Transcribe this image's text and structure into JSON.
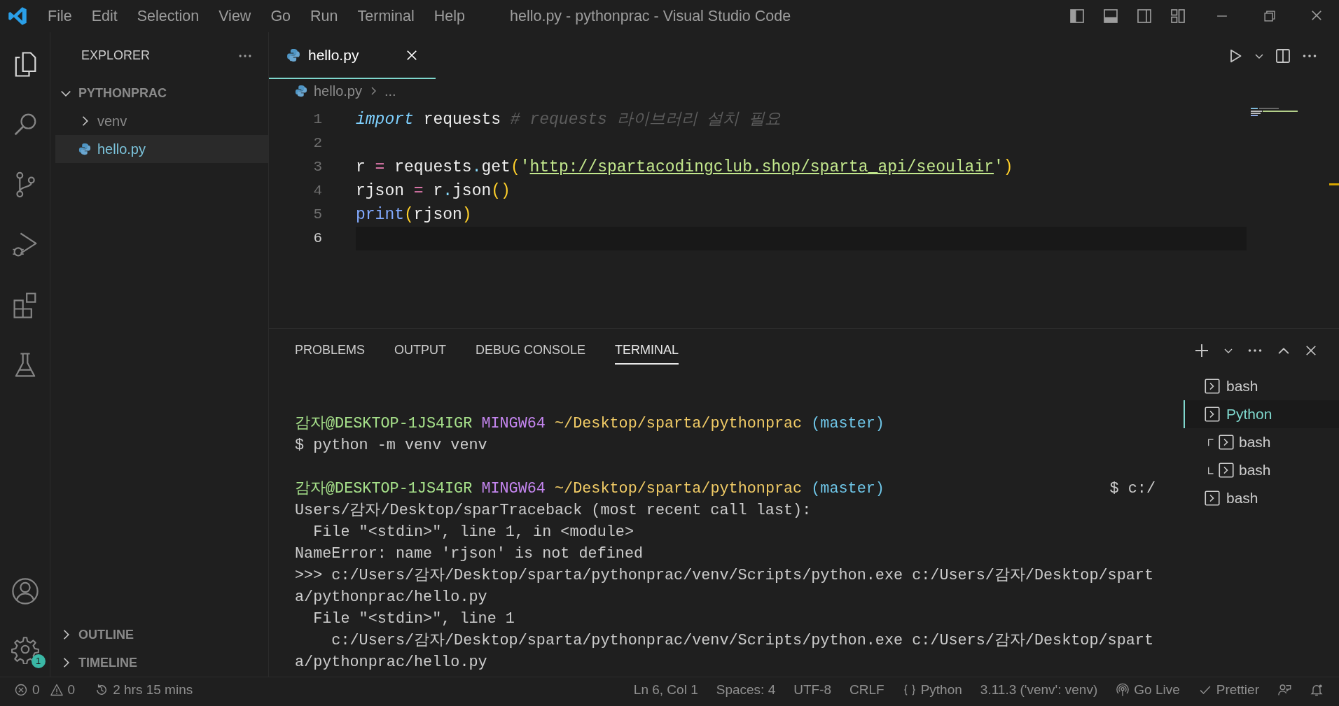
{
  "title_bar": {
    "menu": [
      "File",
      "Edit",
      "Selection",
      "View",
      "Go",
      "Run",
      "Terminal",
      "Help"
    ],
    "title": "hello.py - pythonprac - Visual Studio Code"
  },
  "activity_bar": {
    "items": [
      {
        "kind": "explorer",
        "selected": true
      },
      {
        "kind": "search",
        "selected": false
      },
      {
        "kind": "source-control",
        "selected": false
      },
      {
        "kind": "run-debug",
        "selected": false
      },
      {
        "kind": "extensions",
        "selected": false
      },
      {
        "kind": "testing",
        "selected": false
      }
    ],
    "manage_badge": "1"
  },
  "sidebar": {
    "title": "EXPLORER",
    "folder": {
      "name": "PYTHONPRAC",
      "expanded": true,
      "children": [
        {
          "kind": "folder",
          "name": "venv",
          "expanded": false,
          "selected": false
        },
        {
          "kind": "python",
          "name": "hello.py",
          "selected": true
        }
      ]
    },
    "sections": [
      {
        "name": "OUTLINE",
        "expanded": false
      },
      {
        "name": "TIMELINE",
        "expanded": false
      }
    ]
  },
  "editor": {
    "tabs": [
      {
        "label": "hello.py",
        "selected": true
      }
    ],
    "breadcrumb": {
      "file": "hello.py",
      "rest": "..."
    },
    "lines": [
      {
        "number": "1",
        "current": false,
        "tokens": [
          {
            "kind": "keyword",
            "text": "import"
          },
          {
            "kind": "text",
            "text": " requests "
          },
          {
            "kind": "comment",
            "text": "# requests 라이브러리 설치 필요"
          }
        ]
      },
      {
        "number": "2",
        "current": false
      },
      {
        "number": "3",
        "current": false,
        "tokens": [
          {
            "kind": "text",
            "text": "r "
          },
          {
            "kind": "operator",
            "text": "="
          },
          {
            "kind": "text",
            "text": " requests"
          },
          {
            "kind": "punct",
            "text": "."
          },
          {
            "kind": "text",
            "text": "get"
          },
          {
            "kind": "bracket",
            "text": "("
          },
          {
            "kind": "string",
            "text": "'"
          },
          {
            "kind": "link",
            "text": "http://spartacodingclub.shop/sparta_api/seoulair"
          },
          {
            "kind": "string",
            "text": "'"
          },
          {
            "kind": "bracket",
            "text": ")"
          }
        ]
      },
      {
        "number": "4",
        "current": false,
        "tokens": [
          {
            "kind": "text",
            "text": "rjson "
          },
          {
            "kind": "operator",
            "text": "="
          },
          {
            "kind": "text",
            "text": " r"
          },
          {
            "kind": "punct",
            "text": "."
          },
          {
            "kind": "text",
            "text": "json"
          },
          {
            "kind": "bracket",
            "text": "()"
          }
        ]
      },
      {
        "number": "5",
        "current": false,
        "tokens": [
          {
            "kind": "function",
            "text": "print"
          },
          {
            "kind": "bracket",
            "text": "("
          },
          {
            "kind": "text",
            "text": "rjson"
          },
          {
            "kind": "bracket",
            "text": ")"
          }
        ]
      },
      {
        "number": "6",
        "current": true
      }
    ]
  },
  "panel": {
    "tabs": [
      {
        "label": "PROBLEMS",
        "selected": false
      },
      {
        "label": "OUTPUT",
        "selected": false
      },
      {
        "label": "DEBUG CONSOLE",
        "selected": false
      },
      {
        "label": "TERMINAL",
        "selected": true
      }
    ],
    "terminal_blocks": [
      {
        "lines": [
          {
            "segments": [
              {
                "kind": "user",
                "text": "감자@DESKTOP-1JS4IGR"
              },
              {
                "kind": "system",
                "text": " MINGW64"
              },
              {
                "kind": "path",
                "text": " ~/Desktop/sparta/pythonprac"
              },
              {
                "kind": "branch",
                "text": " (master)"
              }
            ]
          },
          {
            "segments": [
              {
                "kind": "plain",
                "text": "$ python -m venv venv"
              }
            ]
          }
        ]
      },
      {
        "lines": [
          {
            "segments": [
              {
                "kind": "user",
                "text": "감자@DESKTOP-1JS4IGR"
              },
              {
                "kind": "system",
                "text": " MINGW64"
              },
              {
                "kind": "path",
                "text": " ~/Desktop/sparta/pythonprac"
              },
              {
                "kind": "branch",
                "text": " (master)"
              }
            ],
            "right": "$ c:/"
          },
          {
            "segments": [
              {
                "kind": "plain",
                "text": "Users/감자/Desktop/sparTraceback (most recent call last):"
              }
            ]
          },
          {
            "segments": [
              {
                "kind": "plain",
                "text": "  File \"<stdin>\", line 1, in <module>"
              }
            ]
          },
          {
            "segments": [
              {
                "kind": "plain",
                "text": "NameError: name 'rjson' is not defined"
              }
            ]
          },
          {
            "segments": [
              {
                "kind": "plain",
                "text": ">>> c:/Users/감자/Desktop/sparta/pythonprac/venv/Scripts/python.exe c:/Users/감자/Desktop/spart"
              }
            ]
          },
          {
            "segments": [
              {
                "kind": "plain",
                "text": "a/pythonprac/hello.py"
              }
            ]
          },
          {
            "segments": [
              {
                "kind": "plain",
                "text": "  File \"<stdin>\", line 1"
              }
            ]
          },
          {
            "segments": [
              {
                "kind": "plain",
                "text": "    c:/Users/감자/Desktop/sparta/pythonprac/venv/Scripts/python.exe c:/Users/감자/Desktop/spart"
              }
            ]
          },
          {
            "segments": [
              {
                "kind": "plain",
                "text": "a/pythonprac/hello.py"
              }
            ]
          }
        ]
      }
    ],
    "sessions": [
      {
        "kind": "single",
        "name": "bash",
        "selected": false
      },
      {
        "kind": "single",
        "name": "Python",
        "selected": true
      },
      {
        "kind": "group",
        "selected": false,
        "terminals": [
          {
            "name": "bash"
          },
          {
            "name": "bash"
          }
        ]
      },
      {
        "kind": "single",
        "name": "bash",
        "selected": false
      }
    ]
  },
  "status_bar": {
    "left": [
      {
        "kind": "errors",
        "text": "0"
      },
      {
        "kind": "warnings",
        "text": "0"
      },
      {
        "kind": "history",
        "text": "2 hrs 15 mins"
      }
    ],
    "right": [
      {
        "kind": "plain",
        "text": "Ln 6, Col 1"
      },
      {
        "kind": "plain",
        "text": "Spaces: 4"
      },
      {
        "kind": "plain",
        "text": "UTF-8"
      },
      {
        "kind": "plain",
        "text": "CRLF"
      },
      {
        "kind": "language",
        "text": "Python"
      },
      {
        "kind": "plain",
        "text": "3.11.3 ('venv': venv)"
      },
      {
        "kind": "live",
        "text": "Go Live"
      },
      {
        "kind": "check",
        "text": "Prettier"
      },
      {
        "kind": "feedback"
      },
      {
        "kind": "bell"
      }
    ]
  }
}
